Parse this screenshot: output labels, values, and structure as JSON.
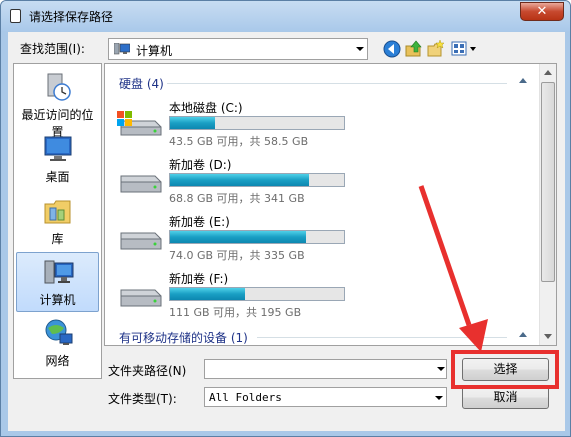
{
  "window": {
    "title": "请选择保存路径",
    "close_label": "✕"
  },
  "toolbar": {
    "lookin_label": "查找范围(I):",
    "lookin_value": "计算机",
    "icons": [
      "back-icon",
      "up-folder-icon",
      "new-folder-icon",
      "view-menu-icon"
    ]
  },
  "places": [
    {
      "label": "最近访问的位置",
      "icon": "recent-places-icon"
    },
    {
      "label": "桌面",
      "icon": "desktop-icon"
    },
    {
      "label": "库",
      "icon": "libraries-icon"
    },
    {
      "label": "计算机",
      "icon": "computer-icon",
      "selected": true
    },
    {
      "label": "网络",
      "icon": "network-icon"
    }
  ],
  "filelist": {
    "groups": [
      {
        "header": "硬盘 (4)"
      },
      {
        "header": "有可移动存储的设备 (1)"
      }
    ],
    "drives": [
      {
        "name": "本地磁盘 (C:)",
        "info": "43.5 GB 可用，共 58.5 GB",
        "used_fraction": 0.26
      },
      {
        "name": "新加卷 (D:)",
        "info": "68.8 GB 可用，共 341 GB",
        "used_fraction": 0.8
      },
      {
        "name": "新加卷 (E:)",
        "info": "74.0 GB 可用，共 335 GB",
        "used_fraction": 0.78
      },
      {
        "name": "新加卷 (F:)",
        "info": "111 GB 可用，共 195 GB",
        "used_fraction": 0.43
      }
    ]
  },
  "form": {
    "path_label": "文件夹路径(N)",
    "path_value": "",
    "type_label": "文件类型(T):",
    "type_value": "All Folders",
    "select_button": "选择",
    "cancel_button": "取消"
  },
  "colors": {
    "highlight": "#e8302e",
    "bar_fill": "#1a9fc4",
    "group_header": "#1e3287"
  }
}
